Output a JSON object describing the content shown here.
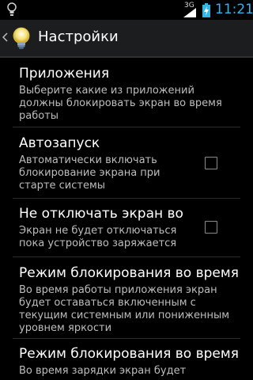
{
  "status_bar": {
    "network_label": "3G",
    "clock": "11:21",
    "accent_color": "#33b5e5"
  },
  "action_bar": {
    "title": "Настройки",
    "up_icon": "chevron-left-icon",
    "app_icon": "lightbulb-icon"
  },
  "preferences": [
    {
      "title": "Приложения",
      "summary_lines": [
        "Выберите какие из приложений",
        "должны блокировать экран во время",
        "работы"
      ],
      "has_checkbox": false
    },
    {
      "title": "Автозапуск",
      "summary_lines": [
        "Автоматически включать",
        "блокирование экрана при",
        "старте системы"
      ],
      "has_checkbox": true,
      "checked": false
    },
    {
      "title": "Не отключать экран во в",
      "summary_lines": [
        "Экран не будет отключаться",
        "пока устройство заряжается"
      ],
      "has_checkbox": true,
      "checked": false
    },
    {
      "title": "Режим блокирования во время",
      "summary_lines": [
        "Во время работы приложения экран",
        "будет оставаться включенным с",
        "текущим системным или пониженным",
        "уровнем яркости"
      ],
      "has_checkbox": false
    },
    {
      "title": "Режим блокирования во время",
      "summary_lines": [
        "Во время зарядки экран будет"
      ],
      "has_checkbox": false
    }
  ]
}
